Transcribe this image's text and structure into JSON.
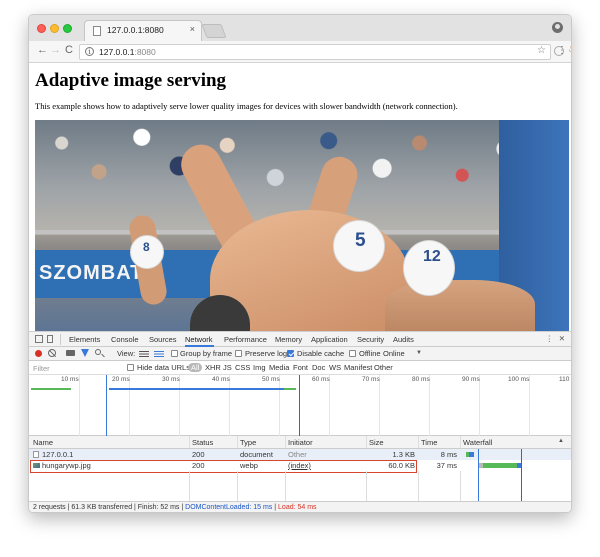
{
  "browser": {
    "tab_title": "127.0.0.1:8080",
    "url_host": "127.0.0.1",
    "url_port": ":8080",
    "info_glyph": "i",
    "star_glyph": "☆",
    "menu_glyph": "⋮",
    "back_glyph": "←",
    "forward_glyph": "→",
    "reload_glyph": "C",
    "close_glyph": "×",
    "ext_glyph": "♨"
  },
  "page": {
    "heading": "Adaptive image serving",
    "description": "This example shows how to adaptively serve lower quality images for devices with slower bandwidth (network connection).",
    "photo": {
      "banner_text": "SZOMBAT",
      "cap_numbers": [
        "5",
        "8",
        "12"
      ]
    }
  },
  "devtools": {
    "tabs": [
      "Elements",
      "Console",
      "Sources",
      "Network",
      "Performance",
      "Memory",
      "Application",
      "Security",
      "Audits"
    ],
    "active_tab": "Network",
    "more_glyph": "⋮",
    "close_glyph": "✕",
    "toolbar": {
      "view_label": "View:",
      "group_by_frame": "Group by frame",
      "preserve_log": "Preserve log",
      "disable_cache": "Disable cache",
      "offline": "Offline",
      "throttle": "Online",
      "caret": "▼"
    },
    "filter": {
      "placeholder": "Filter",
      "hide_data_urls": "Hide data URLs",
      "types": [
        "All",
        "XHR",
        "JS",
        "CSS",
        "Img",
        "Media",
        "Font",
        "Doc",
        "WS",
        "Manifest",
        "Other"
      ]
    },
    "timeline_ticks": [
      "10 ms",
      "20 ms",
      "30 ms",
      "40 ms",
      "50 ms",
      "60 ms",
      "70 ms",
      "80 ms",
      "90 ms",
      "100 ms",
      "110"
    ],
    "columns": [
      "Name",
      "Status",
      "Type",
      "Initiator",
      "Size",
      "Time",
      "Waterfall"
    ],
    "sort_glyph": "▲",
    "rows": [
      {
        "name": "127.0.0.1",
        "status": "200",
        "type": "document",
        "initiator": "Other",
        "size": "1.3 KB",
        "time": "8 ms"
      },
      {
        "name": "hungarywp.jpg",
        "status": "200",
        "type": "webp",
        "initiator": "(index)",
        "size": "60.0 KB",
        "time": "37 ms"
      }
    ],
    "status_bar": {
      "summary": "2 requests | 61.3 KB transferred | Finish: 52 ms | ",
      "dom_content_loaded": "DOMContentLoaded: 15 ms",
      "separator": " | ",
      "load": "Load: 54 ms"
    },
    "colors": {
      "accent": "#3879d9",
      "load": "#d93025",
      "waiting": "#58b958",
      "highlight": "#d9442c"
    }
  }
}
